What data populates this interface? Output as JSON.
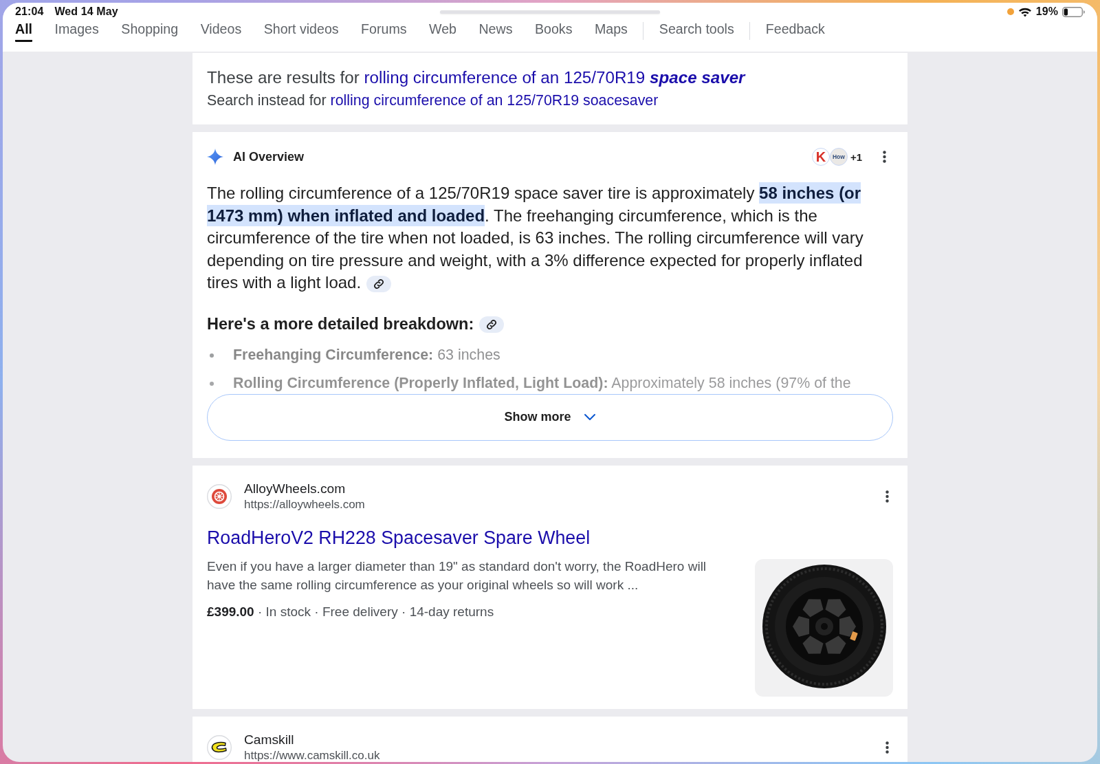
{
  "status_bar": {
    "time": "21:04",
    "date": "Wed 14 May",
    "battery": "19%"
  },
  "tabs": [
    {
      "label": "All",
      "selected": true
    },
    {
      "label": "Images",
      "selected": false
    },
    {
      "label": "Shopping",
      "selected": false
    },
    {
      "label": "Videos",
      "selected": false
    },
    {
      "label": "Short videos",
      "selected": false
    },
    {
      "label": "Forums",
      "selected": false
    },
    {
      "label": "Web",
      "selected": false
    },
    {
      "label": "News",
      "selected": false
    },
    {
      "label": "Books",
      "selected": false
    },
    {
      "label": "Maps",
      "selected": false
    }
  ],
  "tools": [
    "Search tools",
    "Feedback"
  ],
  "spelling": {
    "results_for": "These are results for",
    "corrected_query": "rolling circumference of an 125/70R19 **space saver**",
    "search_instead": "Search instead for",
    "original_query": "rolling circumference of an 125/70R19 soacesaver"
  },
  "ai_overview": {
    "title": "AI Overview",
    "sources": [
      "K",
      "How"
    ],
    "more_sources": "+1",
    "summary": "The rolling circumference of a 125/70R19 space saver tire is approximately **58 inches (or 1473 mm) when inflated and loaded**. The freehanging circumference, which is the circumference of the tire when not loaded, is 63 inches. The rolling circumference will vary depending on tire pressure and weight, with a 3% difference expected for properly inflated tires with a light load.",
    "heading": "Here's a more detailed breakdown:",
    "bullets": [
      "**Freehanging Circumference:** 63 inches",
      "**Rolling Circumference (Properly Inflated, Light Load):** Approximately 58 inches (97% of the"
    ],
    "show_more": "Show more"
  },
  "results": [
    {
      "site": "AlloyWheels.com",
      "url": "https://alloywheels.com",
      "title": "RoadHeroV2 RH228 Spacesaver Spare Wheel",
      "snippet": "Even if you have a larger diameter than 19\" as standard don't worry, the RoadHero will have the same rolling circumference as your original wheels so will work ...",
      "meta": "**£399.00** · In stock · Free delivery · 14-day returns"
    },
    {
      "site": "Camskill",
      "url": "https://www.camskill.co.uk"
    }
  ]
}
